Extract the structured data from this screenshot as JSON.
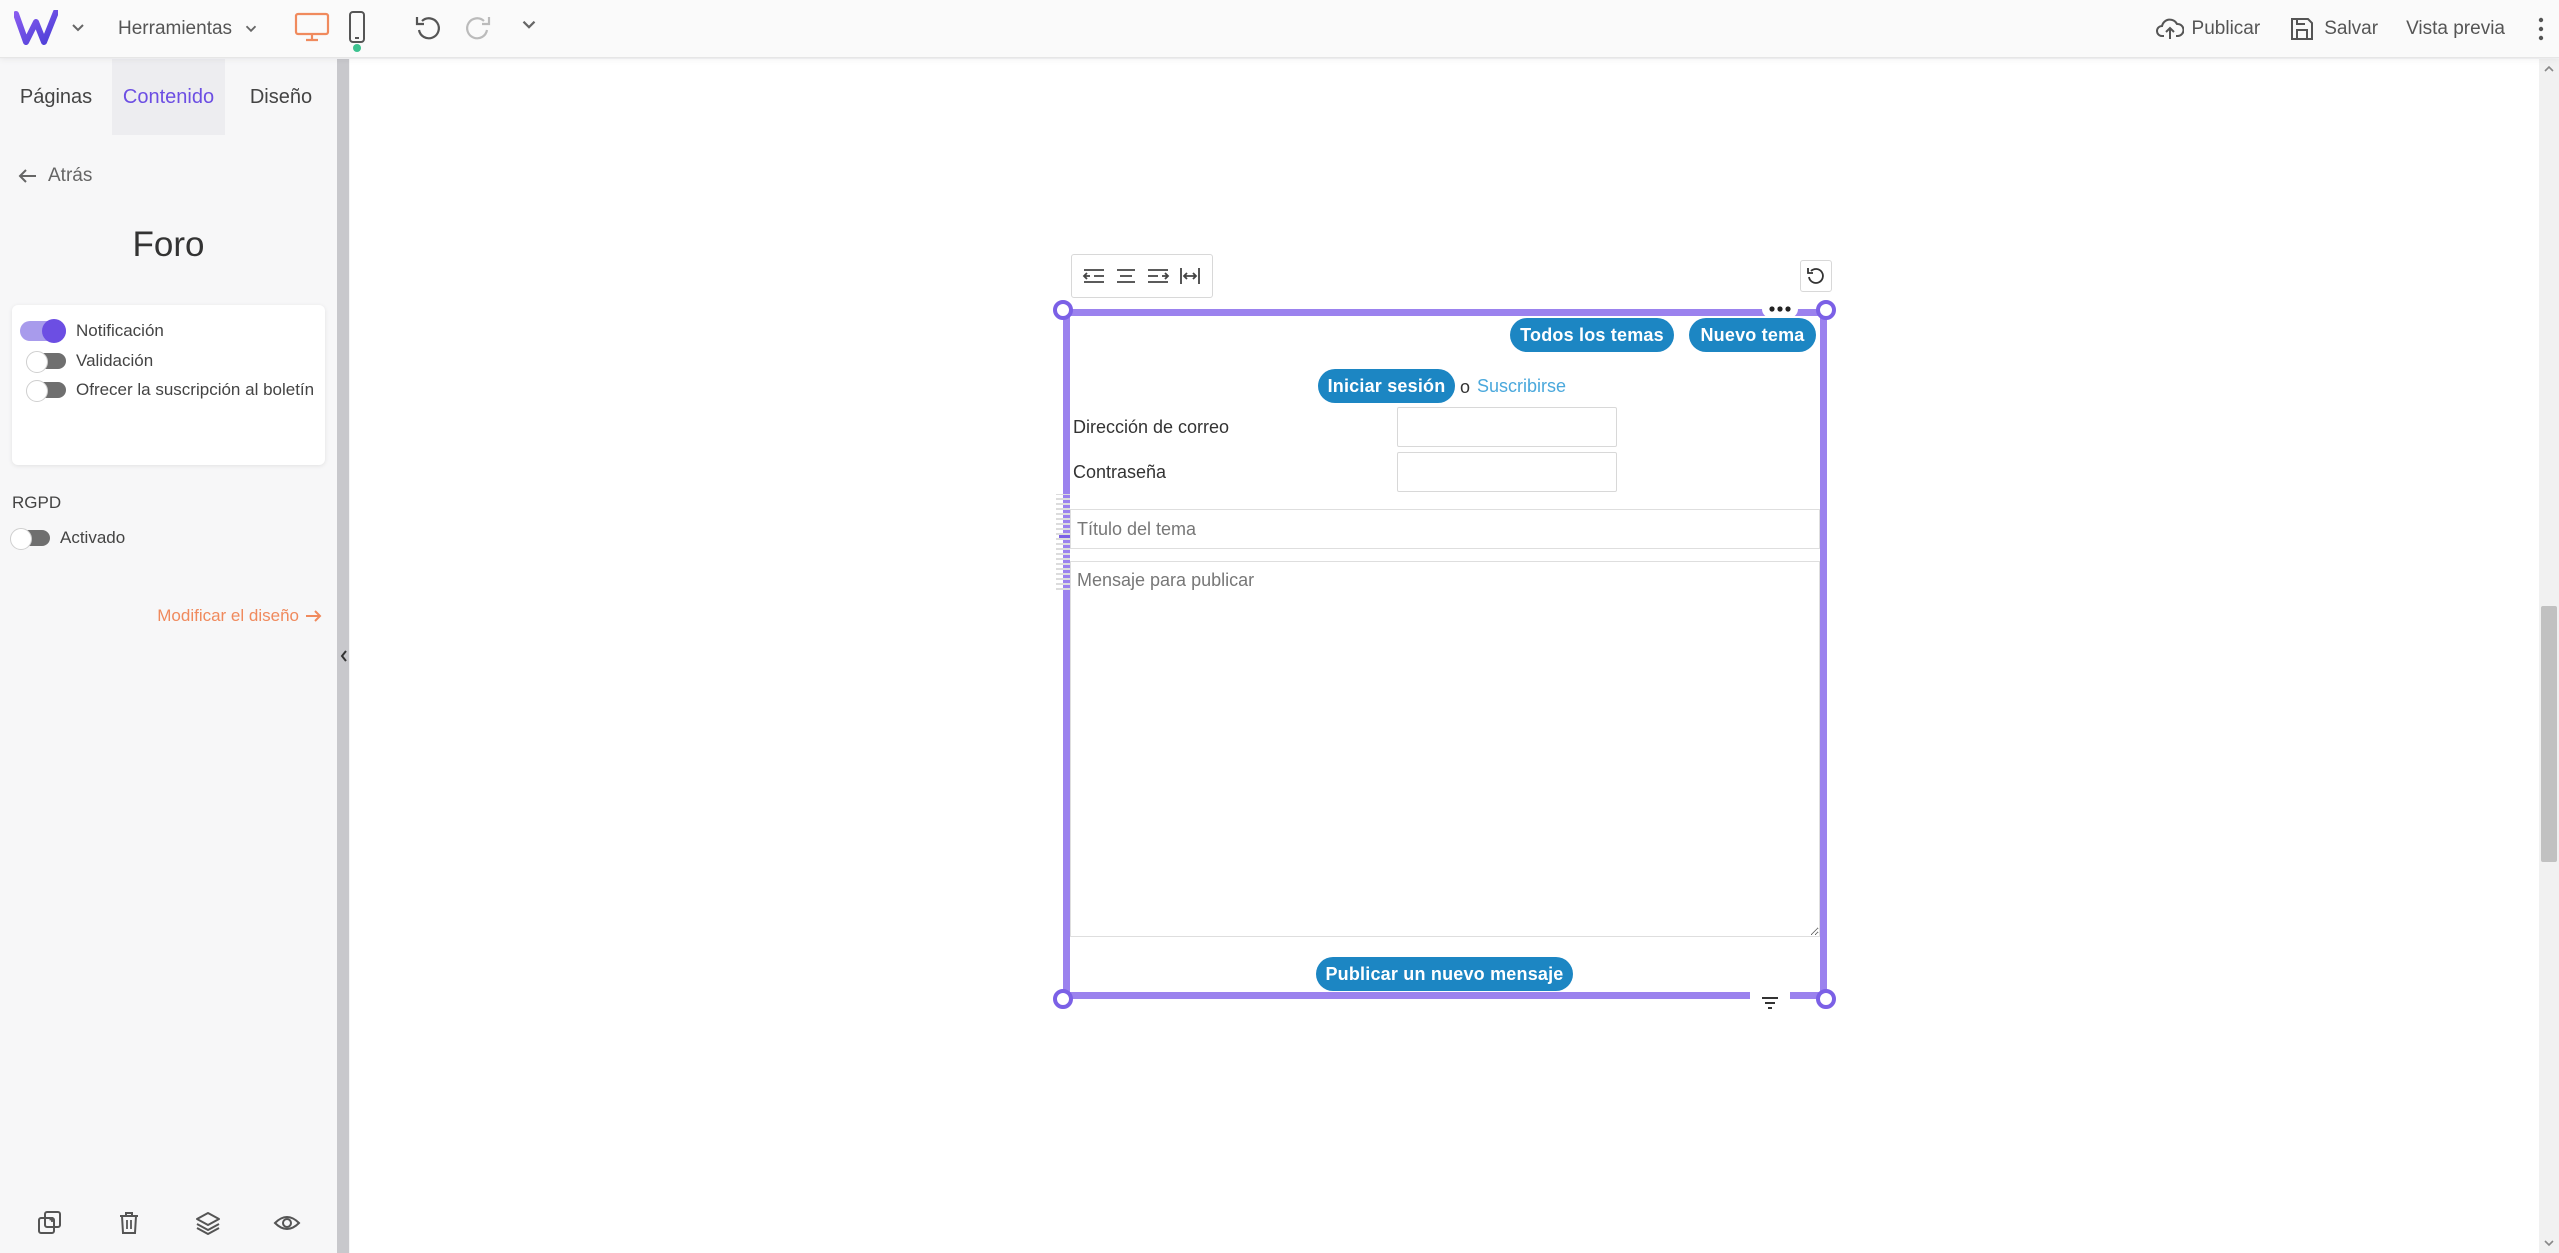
{
  "topbar": {
    "tools_label": "Herramientas",
    "publish_label": "Publicar",
    "save_label": "Salvar",
    "preview_label": "Vista previa"
  },
  "sidebar": {
    "tabs": [
      {
        "label": "Páginas"
      },
      {
        "label": "Contenido",
        "active": true
      },
      {
        "label": "Diseño"
      }
    ],
    "back_label": "Atrás",
    "title": "Foro",
    "toggles": [
      {
        "label": "Notificación",
        "on": true
      },
      {
        "label": "Validación",
        "on": false
      },
      {
        "label": "Ofrecer la suscripción al boletín",
        "on": false
      }
    ],
    "rgpd": {
      "section_label": "RGPD",
      "toggle_label": "Activado",
      "on": false
    },
    "modify_design_label": "Modificar el diseño"
  },
  "forum": {
    "all_topics_label": "Todos los temas",
    "new_topic_label": "Nuevo tema",
    "login_label": "Iniciar sesión",
    "or_label": "o",
    "subscribe_label": "Suscribirse",
    "email_label": "Dirección de correo",
    "password_label": "Contraseña",
    "topic_title_placeholder": "Título del tema",
    "message_placeholder": "Mensaje para publicar",
    "publish_message_label": "Publicar un nuevo mensaje"
  },
  "colors": {
    "accent": "#6c4ee3",
    "selection": "#9b82ee",
    "button": "#1c86c3",
    "link": "#4aa8dc",
    "modify_link": "#f08a5d",
    "desktop_icon": "#f08a5d",
    "mobile_active_dot": "#3cc28f"
  },
  "icons": {
    "logo": "w-logo",
    "desktop": "desktop-icon",
    "mobile": "mobile-icon",
    "undo": "undo-icon",
    "redo": "redo-icon",
    "publish": "cloud-upload-icon",
    "save": "save-icon",
    "more": "kebab-icon",
    "back": "arrow-left-icon",
    "footer": [
      "duplicate-icon",
      "trash-icon",
      "layers-icon",
      "eye-icon"
    ]
  }
}
